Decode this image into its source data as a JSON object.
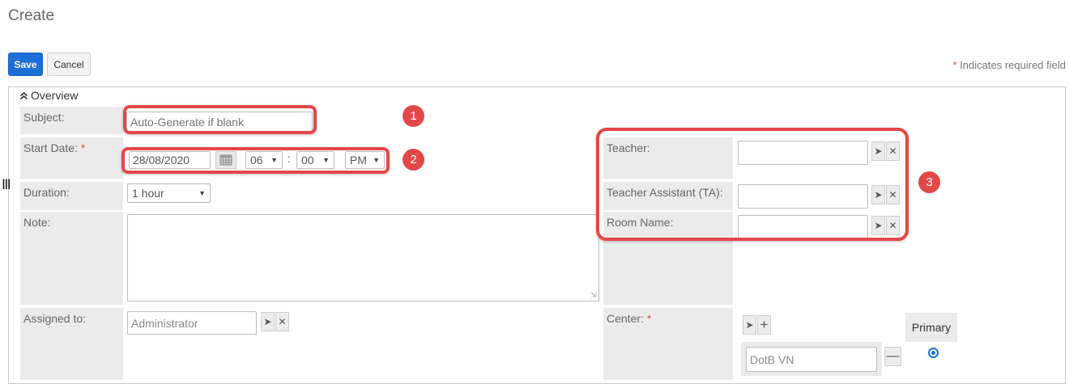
{
  "page": {
    "title": "Create"
  },
  "toolbar": {
    "save_label": "Save",
    "cancel_label": "Cancel"
  },
  "required_note": {
    "star": "*",
    "text": "Indicates required field"
  },
  "panel": {
    "title": "Overview",
    "toggle_icon": "double-chevron-up-icon"
  },
  "form": {
    "subject": {
      "label": "Subject:",
      "placeholder": "Auto-Generate if blank"
    },
    "start_date": {
      "label": "Start Date:",
      "star": "*",
      "date": "28/08/2020",
      "hour": "06",
      "colon": ":",
      "minute": "00",
      "ampm": "PM"
    },
    "duration": {
      "label": "Duration:",
      "value": "1 hour"
    },
    "note": {
      "label": "Note:"
    },
    "assigned_to": {
      "label": "Assigned to:",
      "value": "Administrator"
    },
    "teacher": {
      "label": "Teacher:"
    },
    "teacher_assistant": {
      "label": "Teacher Assistant (TA):"
    },
    "room_name": {
      "label": "Room Name:"
    },
    "center": {
      "label": "Center:",
      "star": "*",
      "value": "DotB VN",
      "primary_label": "Primary"
    }
  },
  "annotations": [
    "1",
    "2",
    "3"
  ],
  "colors": {
    "save_button": "#1d6fd8",
    "highlight": "#e24848",
    "required": "#d9534f"
  }
}
